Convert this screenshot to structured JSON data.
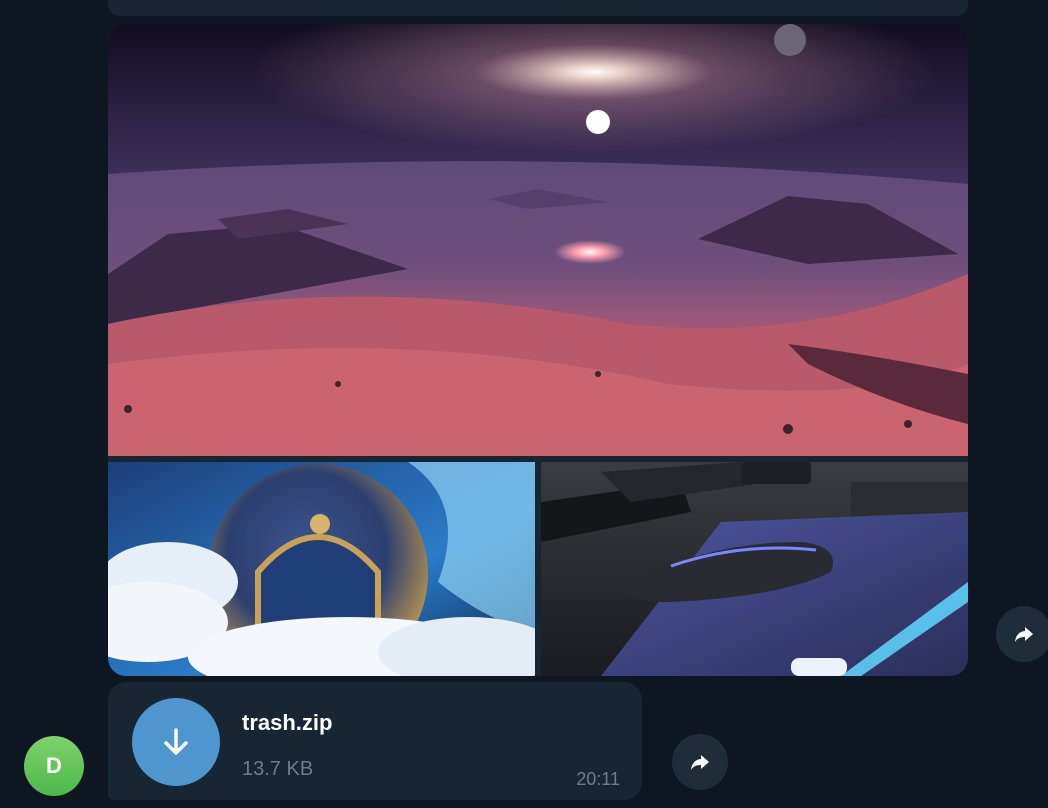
{
  "album": {
    "photos": [
      {
        "id": "main",
        "description": "Pink desert planet landscape with sun on horizon"
      },
      {
        "id": "left",
        "description": "Ornate golden sphere with arch amid clouds"
      },
      {
        "id": "right",
        "description": "Computer mouse on glowing RGB mouse pad"
      }
    ],
    "forward_icon": "share-arrow-icon"
  },
  "file_message": {
    "file_name": "trash.zip",
    "file_size": "13.7 KB",
    "time": "20:11",
    "download_icon": "download-arrow-icon",
    "forward_icon": "share-arrow-icon"
  },
  "sender": {
    "avatar_initial": "D",
    "avatar_color": "#5cc152"
  },
  "colors": {
    "background": "#0e1621",
    "bubble": "#182533",
    "accent": "#4f96cf",
    "muted_text": "#6c7d8e"
  }
}
